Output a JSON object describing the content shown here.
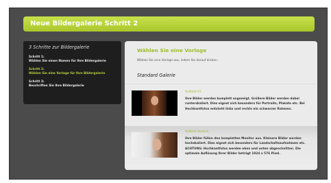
{
  "header": {
    "title": "Neue Bildergalerie Schritt 2"
  },
  "steps": {
    "heading": "3 Schritte zur Bildergalerie",
    "items": [
      {
        "title": "Schritt 1:",
        "desc": "Wählen Sie einen Namen für Ihre Bildergalerie",
        "active": false
      },
      {
        "title": "Schritt 2:",
        "desc": "Wählen Sie eine Vorlage für Ihre Bildergalerie",
        "active": true
      },
      {
        "title": "Schritt 3:",
        "desc": "Beschriften Sie Ihre Bildergalerie",
        "active": false
      }
    ]
  },
  "main": {
    "title": "Wählen Sie eine Vorlage",
    "intro": "Wählen Sie eine Vorlage aus, indem Sie darauf klicken.",
    "section_heading": "Standard Galerie",
    "templates": [
      {
        "title": "Vollbild Fit",
        "description": "Ihre Bilder werden komplett angezeigt. Größere Bilder werden dabei runterskaliert. Dies eignet sich besonders für Portraits, Plakate etc. Bei Hochkantfotos entsteht links und rechts ein schwarzer Rahmen."
      },
      {
        "title": "Vollbild Stretch",
        "description": "Ihre Bilder füllen den kompletten Monitor aus. Kleinere Bilder werden hochskaliert. Dies eignet sich besonders für Landschaftsaufnahmen etc. ACHTUNG: Hochkantfotos werden oben und unten abgeschnitten. Die optimale Auflösung Ihrer Bilder beträgt 1024 x 576 Pixel."
      }
    ]
  },
  "colors": {
    "accent": "#a9c72b",
    "dark_panel": "#1e1e1e",
    "background": "#4b4b4b"
  }
}
